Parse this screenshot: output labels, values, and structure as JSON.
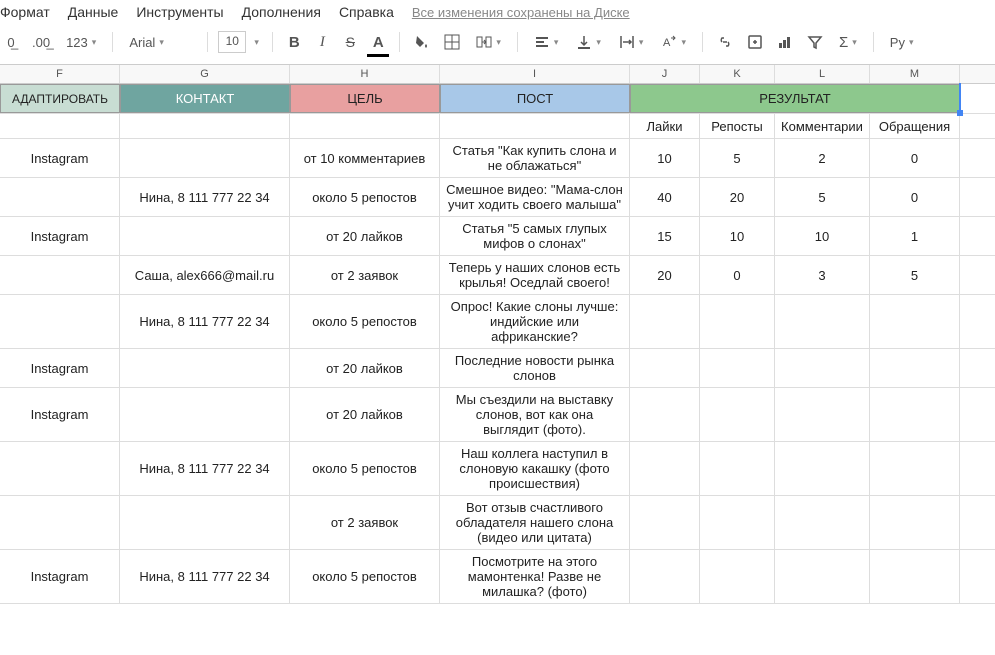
{
  "menu": {
    "format": "Формат",
    "data": "Данные",
    "tools": "Инструменты",
    "addons": "Дополнения",
    "help": "Справка",
    "saved": "Все изменения сохранены на Диске"
  },
  "toolbar": {
    "dec0": "0̲",
    "dec00": ".00̲",
    "fmt123": "123",
    "font_name": "Arial",
    "font_size": "10",
    "bold": "B",
    "italic": "I",
    "strike": "S",
    "textcolor": "A",
    "locale": "Py"
  },
  "cols": {
    "F": "F",
    "G": "G",
    "H": "H",
    "I": "I",
    "J": "J",
    "K": "K",
    "L": "L",
    "M": "M"
  },
  "headers": {
    "adapt": "АДАПТИРОВАТЬ",
    "contact": "КОНТАКТ",
    "goal": "ЦЕЛЬ",
    "post": "ПОСТ",
    "result": "РЕЗУЛЬТАТ",
    "likes": "Лайки",
    "reposts": "Репосты",
    "comments": "Комментарии",
    "requests": "Обращения"
  },
  "rows": [
    {
      "adapt": "Instagram",
      "contact": "",
      "goal": "от 10 комментариев",
      "post": "Статья \"Как купить слона и не облажаться\"",
      "likes": "10",
      "reposts": "5",
      "comments": "2",
      "requests": "0"
    },
    {
      "adapt": "",
      "contact": "Нина, 8 111 777 22 34",
      "goal": "около 5 репостов",
      "post": "Смешное видео: \"Мама-слон учит ходить своего малыша\"",
      "likes": "40",
      "reposts": "20",
      "comments": "5",
      "requests": "0"
    },
    {
      "adapt": "Instagram",
      "contact": "",
      "goal": "от 20 лайков",
      "post": "Статья \"5 самых глупых мифов о слонах\"",
      "likes": "15",
      "reposts": "10",
      "comments": "10",
      "requests": "1"
    },
    {
      "adapt": "",
      "contact": "Саша, alex666@mail.ru",
      "goal": "от 2 заявок",
      "post": "Теперь у наших слонов есть крылья! Оседлай своего!",
      "likes": "20",
      "reposts": "0",
      "comments": "3",
      "requests": "5"
    },
    {
      "adapt": "",
      "contact": "Нина, 8 111 777 22 34",
      "goal": "около 5 репостов",
      "post": "Опрос! Какие слоны лучше: индийские или африканские?",
      "likes": "",
      "reposts": "",
      "comments": "",
      "requests": ""
    },
    {
      "adapt": "Instagram",
      "contact": "",
      "goal": "от 20 лайков",
      "post": "Последние новости рынка слонов",
      "likes": "",
      "reposts": "",
      "comments": "",
      "requests": ""
    },
    {
      "adapt": "Instagram",
      "contact": "",
      "goal": "от 20 лайков",
      "post": "Мы съездили на выставку слонов, вот как она выглядит (фото).",
      "likes": "",
      "reposts": "",
      "comments": "",
      "requests": ""
    },
    {
      "adapt": "",
      "contact": "Нина, 8 111 777 22 34",
      "goal": "около 5 репостов",
      "post": "Наш коллега наступил в слоновую какашку (фото происшествия)",
      "likes": "",
      "reposts": "",
      "comments": "",
      "requests": ""
    },
    {
      "adapt": "",
      "contact": "",
      "goal": "от 2 заявок",
      "post": "Вот отзыв счастливого обладателя нашего слона (видео или цитата)",
      "likes": "",
      "reposts": "",
      "comments": "",
      "requests": ""
    },
    {
      "adapt": "Instagram",
      "contact": "Нина, 8 111 777 22 34",
      "goal": "около 5 репостов",
      "post": "Посмотрите на этого мамонтенка! Разве не милашка? (фото)",
      "likes": "",
      "reposts": "",
      "comments": "",
      "requests": ""
    }
  ]
}
